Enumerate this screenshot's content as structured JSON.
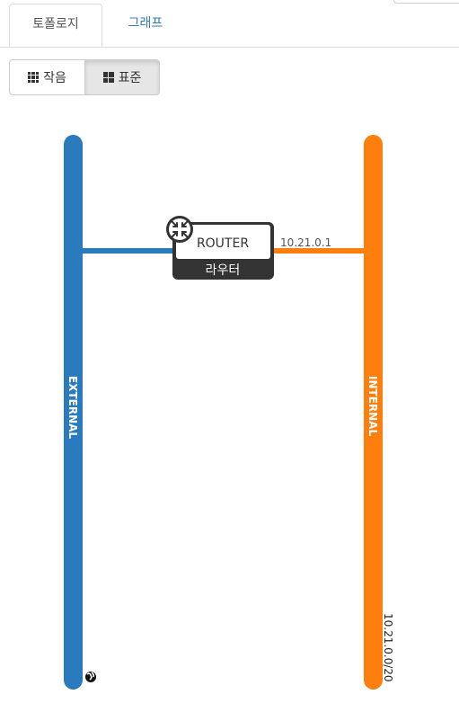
{
  "tabs": [
    {
      "label": "토폴로지",
      "active": true
    },
    {
      "label": "그래프",
      "active": false
    }
  ],
  "view_toggle": {
    "small_label": "작음",
    "normal_label": "표준",
    "selected": "normal"
  },
  "networks": {
    "external": {
      "name": "EXTERNAL",
      "color": "#2a7bbd",
      "icon": "globe-icon"
    },
    "internal": {
      "name": "INTERNAL",
      "color": "#ff7f0e",
      "cidr": "10.21.0.0/20"
    }
  },
  "router": {
    "name": "ROUTER",
    "type_label": "라우터",
    "icon": "router-icon",
    "internal_port_ip": "10.21.0.1"
  }
}
